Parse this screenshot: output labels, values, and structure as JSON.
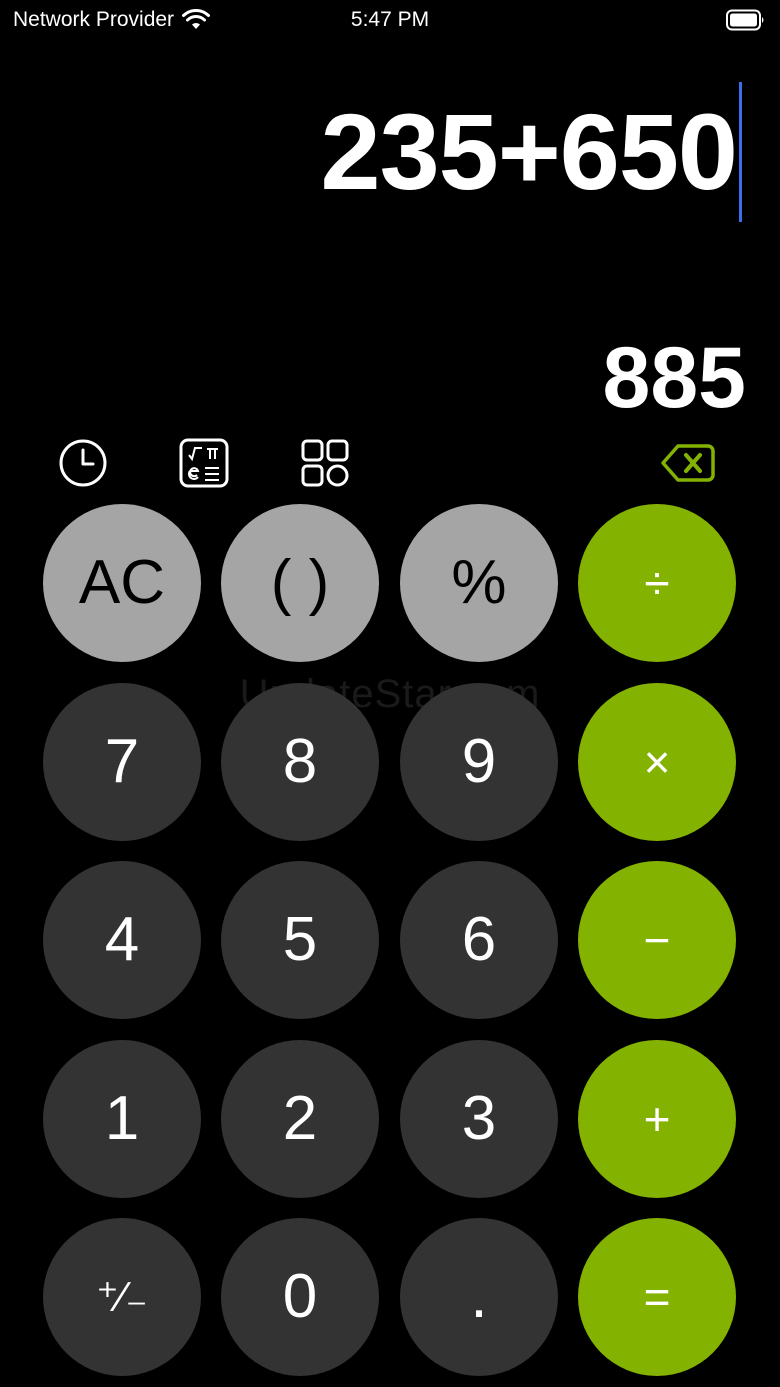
{
  "status_bar": {
    "carrier": "Network Provider",
    "time": "5:47 PM",
    "icons": [
      "wifi-icon",
      "battery-icon"
    ]
  },
  "display": {
    "expression": "235+650",
    "result": "885"
  },
  "toolbar": {
    "icons": [
      "history-icon",
      "scientific-functions-icon",
      "apps-grid-icon",
      "backspace-icon"
    ]
  },
  "keypad": {
    "rows": [
      [
        "AC",
        "( )",
        "%",
        "÷"
      ],
      [
        "7",
        "8",
        "9",
        "×"
      ],
      [
        "4",
        "5",
        "6",
        "−"
      ],
      [
        "1",
        "2",
        "3",
        "+"
      ],
      [
        "⁺∕₋",
        "0",
        ".",
        "="
      ]
    ]
  },
  "watermark": "UpdateStar.com",
  "colors": {
    "background": "#000000",
    "function_key": "#a5a5a5",
    "number_key": "#333333",
    "operator_key": "#84b200",
    "accent_green": "#84b200",
    "cursor": "#3b6fe8"
  }
}
